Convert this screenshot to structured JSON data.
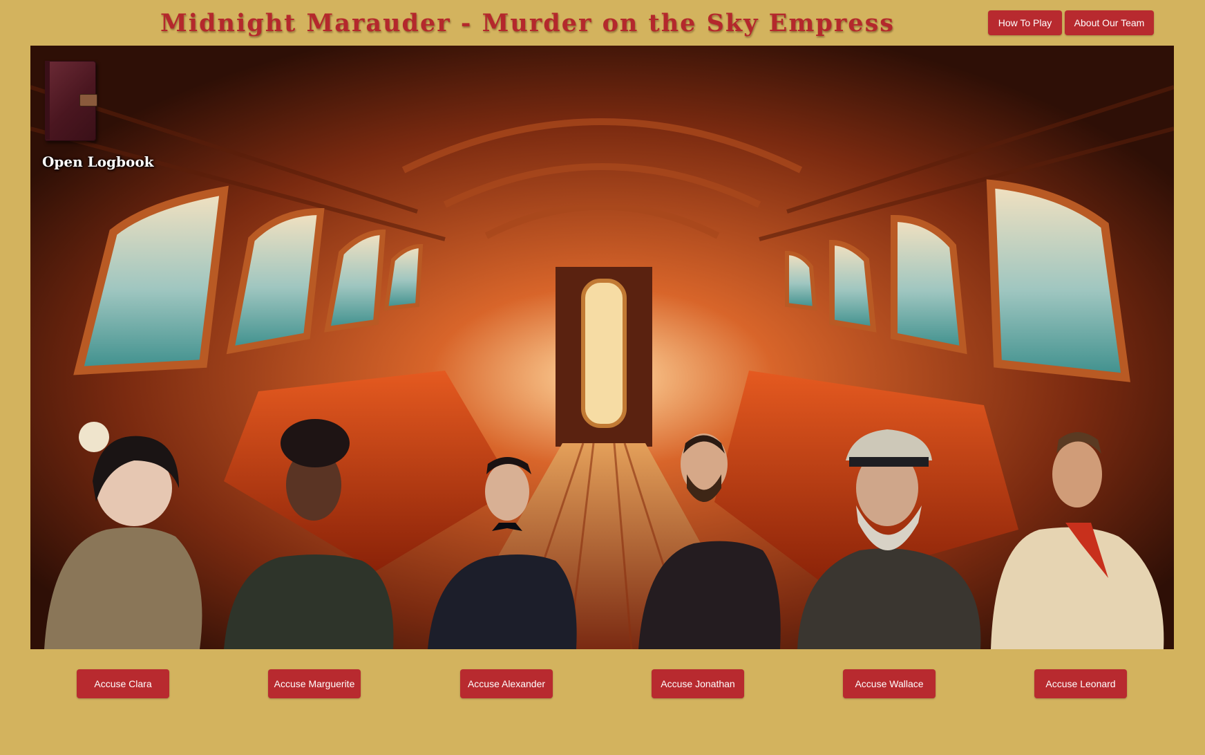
{
  "header": {
    "title": "Midnight Marauder - Murder on the Sky Empress",
    "nav": {
      "how_to_play": "How To Play",
      "about_team": "About Our Team"
    }
  },
  "scene": {
    "logbook_label": "Open Logbook",
    "logbook_icon": "logbook-icon"
  },
  "suspects": [
    {
      "name": "Clara",
      "accuse_label": "Accuse Clara"
    },
    {
      "name": "Marguerite",
      "accuse_label": "Accuse Marguerite"
    },
    {
      "name": "Alexander",
      "accuse_label": "Accuse Alexander"
    },
    {
      "name": "Jonathan",
      "accuse_label": "Accuse Jonathan"
    },
    {
      "name": "Wallace",
      "accuse_label": "Accuse Wallace"
    },
    {
      "name": "Leonard",
      "accuse_label": "Accuse Leonard"
    }
  ],
  "colors": {
    "background": "#d3b35e",
    "accent": "#b82a2f",
    "title": "#b4282c",
    "button_text": "#ffffff"
  }
}
